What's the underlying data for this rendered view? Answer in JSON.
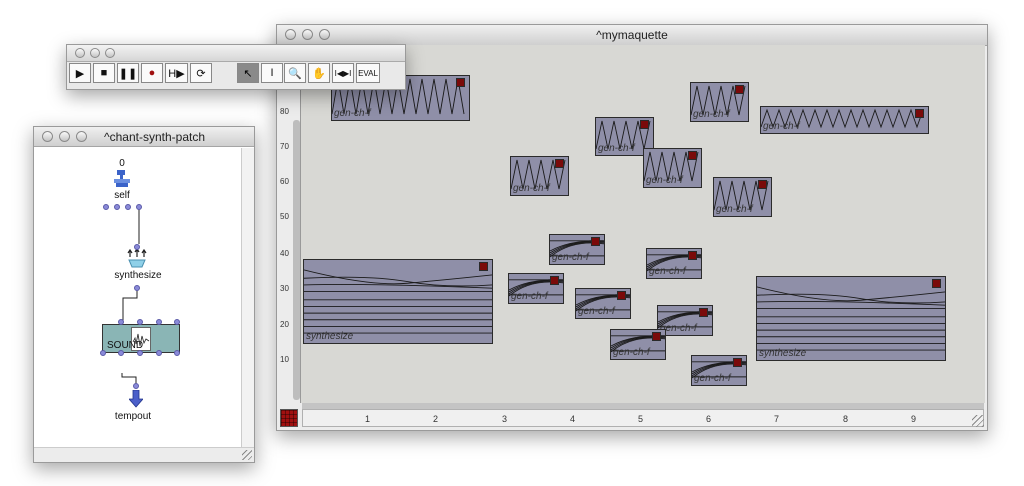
{
  "maquette_window": {
    "title": "^mymaquette",
    "y_ticks": [
      "10",
      "20",
      "30",
      "40",
      "50",
      "60",
      "70",
      "80"
    ],
    "x_ticks": [
      "1",
      "2",
      "3",
      "4",
      "5",
      "6",
      "7",
      "8",
      "9"
    ],
    "clip_labels": {
      "chant": "synthesize",
      "gen": "gen-ch-f"
    }
  },
  "toolbar_window": {
    "buttons": [
      {
        "name": "play-button",
        "glyph": "▶"
      },
      {
        "name": "stop-button",
        "glyph": "■"
      },
      {
        "name": "pause-button",
        "glyph": "❚❚"
      },
      {
        "name": "record-button",
        "glyph": "●"
      },
      {
        "name": "play-from-start-button",
        "glyph": "H▶"
      },
      {
        "name": "loop-button",
        "glyph": "⟳"
      },
      {
        "name": "select-tool-button",
        "glyph": "↖"
      },
      {
        "name": "text-cursor-tool-button",
        "glyph": "I"
      },
      {
        "name": "zoom-tool-button",
        "glyph": "🔍"
      },
      {
        "name": "hand-tool-button",
        "glyph": "✋"
      },
      {
        "name": "fit-interval-button",
        "glyph": "I◀▶I"
      },
      {
        "name": "eval-button",
        "glyph": "EVAL"
      }
    ]
  },
  "patch_window": {
    "title": "^chant-synth-patch",
    "self_value": "0",
    "nodes": {
      "self": "self",
      "synthesize": "synthesize",
      "sound": "SOUND",
      "tempout": "tempout"
    }
  },
  "colors": {
    "clip_fill": "#8f8fa8",
    "marker": "#7a0a0a",
    "canvas_bg": "#d8d8d4",
    "port": "#8a8ad8"
  }
}
